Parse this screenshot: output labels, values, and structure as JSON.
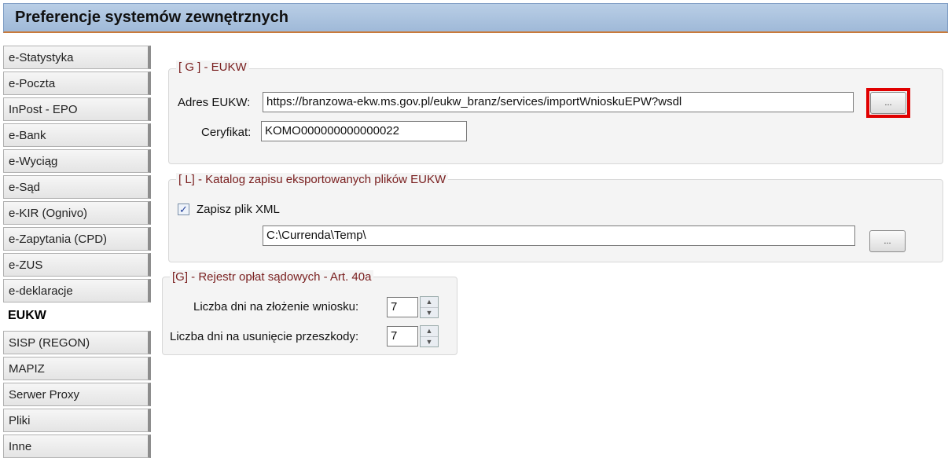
{
  "window": {
    "title": "Preferencje systemów zewnętrznych"
  },
  "sidebar": {
    "items": [
      {
        "label": "e-Statystyka"
      },
      {
        "label": "e-Poczta"
      },
      {
        "label": "InPost - EPO"
      },
      {
        "label": "e-Bank"
      },
      {
        "label": "e-Wyciąg"
      },
      {
        "label": "e-Sąd"
      },
      {
        "label": "e-KIR (Ognivo)"
      },
      {
        "label": "e-Zapytania (CPD)"
      },
      {
        "label": "e-ZUS"
      },
      {
        "label": "e-deklaracje"
      },
      {
        "label": "EUKW"
      },
      {
        "label": "SISP (REGON)"
      },
      {
        "label": "MAPIZ"
      },
      {
        "label": "Serwer Proxy"
      },
      {
        "label": "Pliki"
      },
      {
        "label": "Inne"
      }
    ],
    "active": "EUKW"
  },
  "eukw_group": {
    "legend": "[ G ] - EUKW",
    "address_label": "Adres EUKW:",
    "address_value": "https://branzowa-ekw.ms.gov.pl/eukw_branz/services/importWnioskuEPW?wsdl",
    "browse_label": "...",
    "cert_label": "Ceryfikat:",
    "cert_value": "KOMO000000000000022"
  },
  "catalog_group": {
    "legend": "[ L] - Katalog zapisu eksportowanych plików EUKW",
    "save_xml_label": "Zapisz plik XML",
    "save_xml_checked": true,
    "path_value": "C:\\Currenda\\Temp\\",
    "browse_label": "..."
  },
  "fees_group": {
    "legend": "[G] - Rejestr opłat sądowych - Art. 40a",
    "days_submit_label": "Liczba dni na złożenie wniosku:",
    "days_submit_value": "7",
    "days_remove_label": "Liczba dni na usunięcie przeszkody:",
    "days_remove_value": "7"
  },
  "colors": {
    "highlight": "#e00000",
    "legend_text": "#7a2020",
    "title_bar": "#a9c2df"
  },
  "icons": {
    "checkbox": "checkmark-icon",
    "spinner_up": "up-arrow-icon",
    "spinner_down": "down-arrow-icon"
  }
}
